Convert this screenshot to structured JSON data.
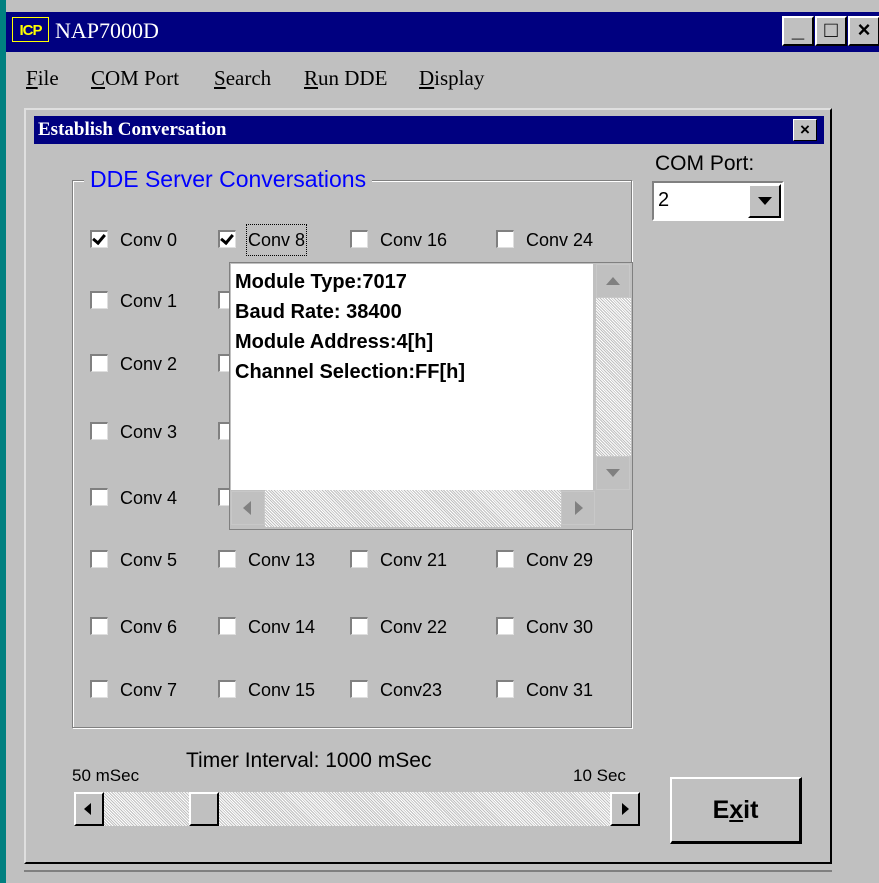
{
  "window": {
    "title": "NAP7000D",
    "icon_text": "ICP",
    "buttons": {
      "minimize": "_",
      "maximize": "□",
      "close": "×"
    }
  },
  "menu": [
    {
      "label": "File",
      "accel": "F",
      "rest": "ile"
    },
    {
      "label": "COM Port",
      "accel": "C",
      "rest": "OM Port"
    },
    {
      "label": "Search",
      "accel": "S",
      "rest": "earch"
    },
    {
      "label": "Run DDE",
      "accel": "R",
      "rest": "un DDE"
    },
    {
      "label": "Display",
      "accel": "D",
      "rest": "isplay"
    }
  ],
  "dialog": {
    "title": "Establish Conversation",
    "close": "×",
    "group_label": "DDE Server Conversations",
    "conversations": [
      {
        "label": "Conv 0",
        "checked": true
      },
      {
        "label": "Conv 1",
        "checked": false
      },
      {
        "label": "Conv 2",
        "checked": false
      },
      {
        "label": "Conv 3",
        "checked": false
      },
      {
        "label": "Conv 4",
        "checked": false
      },
      {
        "label": "Conv 5",
        "checked": false
      },
      {
        "label": "Conv 6",
        "checked": false
      },
      {
        "label": "Conv 7",
        "checked": false
      },
      {
        "label": "Conv 8",
        "checked": true
      },
      {
        "label": "",
        "checked": false
      },
      {
        "label": "",
        "checked": false
      },
      {
        "label": "",
        "checked": false
      },
      {
        "label": "",
        "checked": false
      },
      {
        "label": "Conv 13",
        "checked": false
      },
      {
        "label": "Conv 14",
        "checked": false
      },
      {
        "label": "Conv 15",
        "checked": false
      },
      {
        "label": "Conv 16",
        "checked": false
      },
      {
        "label": "Conv 21",
        "checked": false
      },
      {
        "label": "Conv 22",
        "checked": false
      },
      {
        "label": "Conv23",
        "checked": false
      },
      {
        "label": "Conv 24",
        "checked": false
      },
      {
        "label": "Conv 29",
        "checked": false
      },
      {
        "label": "Conv 30",
        "checked": false
      },
      {
        "label": "Conv 31",
        "checked": false
      }
    ],
    "com_port": {
      "label": "COM Port:",
      "value": "2"
    },
    "info_popup": {
      "lines": [
        "Module Type:7017",
        "Baud Rate: 38400",
        "Module Address:4[h]",
        "Channel Selection:FF[h]"
      ]
    },
    "timer": {
      "label": "Timer Interval: 1000 mSec",
      "min_label": "50 mSec",
      "max_label": "10 Sec",
      "value_ms": 1000
    },
    "exit": {
      "label": "Exit",
      "accel": "x",
      "pre": "E",
      "post": "it"
    }
  }
}
